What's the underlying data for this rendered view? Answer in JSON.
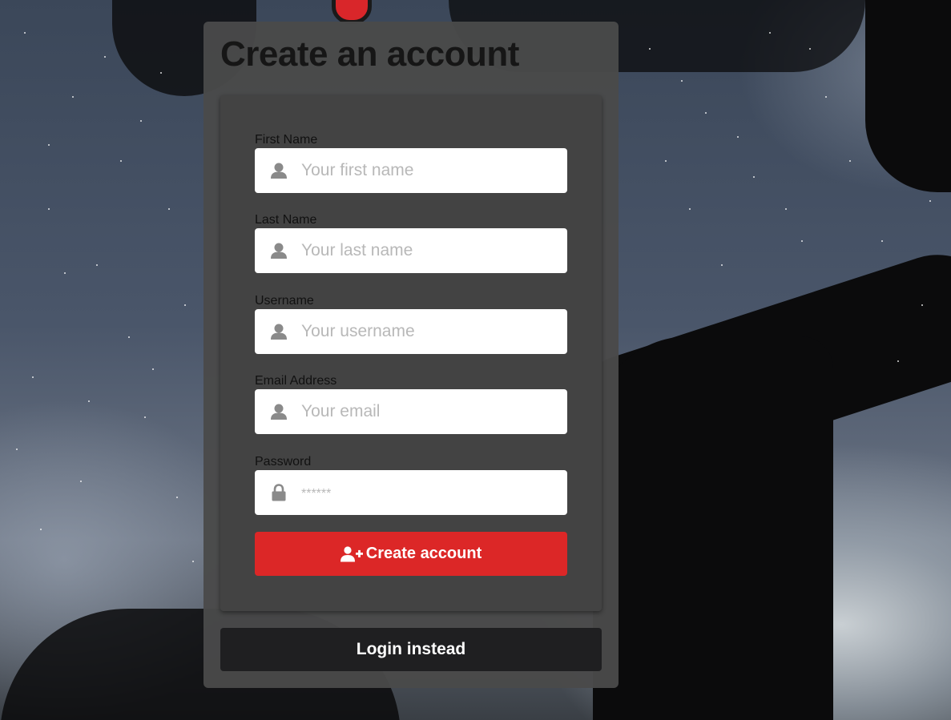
{
  "page": {
    "title": "Create an account"
  },
  "form": {
    "fields": [
      {
        "label": "First Name",
        "placeholder": "Your first name",
        "icon": "user-icon"
      },
      {
        "label": "Last Name",
        "placeholder": "Your last name",
        "icon": "user-icon"
      },
      {
        "label": "Username",
        "placeholder": "Your username",
        "icon": "user-icon"
      },
      {
        "label": "Email Address",
        "placeholder": "Your email",
        "icon": "user-icon"
      },
      {
        "label": "Password",
        "placeholder": "******",
        "icon": "lock-icon"
      }
    ],
    "submit_label": "Create account",
    "submit_icon": "user-plus-icon",
    "submit_color": "#dc2727"
  },
  "login_button": {
    "label": "Login instead",
    "color": "#1f1f21"
  }
}
